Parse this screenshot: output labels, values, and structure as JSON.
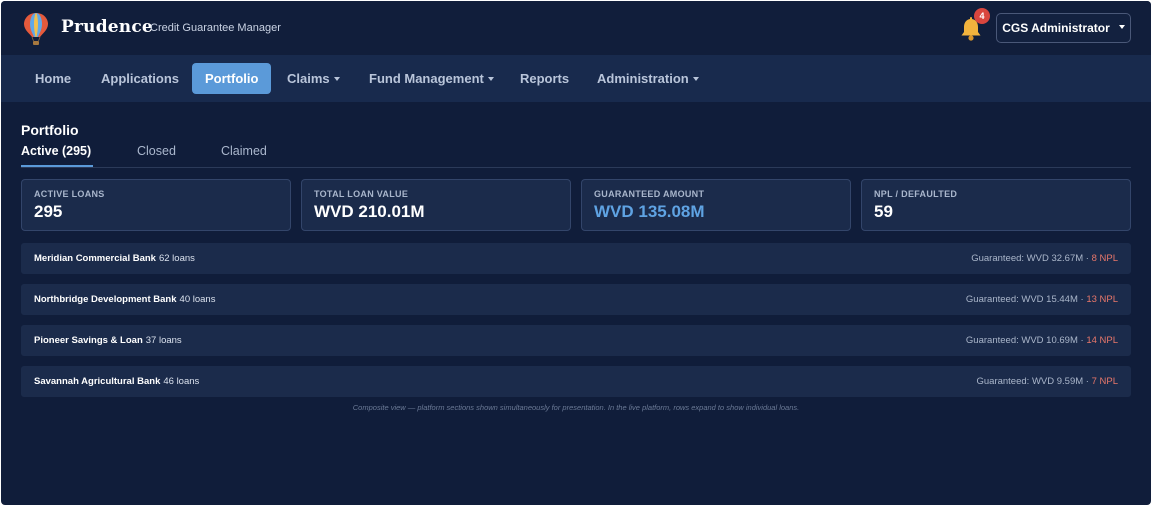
{
  "brand": {
    "name": "Prudence",
    "subtitle": "Credit Guarantee Manager"
  },
  "notifications": {
    "count": "4"
  },
  "user": {
    "label": "CGS Administrator"
  },
  "nav": {
    "items": [
      {
        "label": "Home"
      },
      {
        "label": "Applications"
      },
      {
        "label": "Portfolio"
      },
      {
        "label": "Claims"
      },
      {
        "label": "Fund Management"
      },
      {
        "label": "Reports"
      },
      {
        "label": "Administration"
      }
    ],
    "active": "Portfolio"
  },
  "page": {
    "title": "Portfolio",
    "tabs": [
      {
        "label": "Active (295)"
      },
      {
        "label": "Closed"
      },
      {
        "label": "Claimed"
      }
    ]
  },
  "stats": [
    {
      "label": "ACTIVE LOANS",
      "value": "295"
    },
    {
      "label": "TOTAL LOAN VALUE",
      "value": "WVD 210.01M"
    },
    {
      "label": "GUARANTEED AMOUNT",
      "value": "WVD 135.08M"
    },
    {
      "label": "NPL / DEFAULTED",
      "value": "59"
    }
  ],
  "banks": [
    {
      "name": "Meridian Commercial Bank",
      "loans": "62 loans",
      "guaranteed": "Guaranteed: WVD 32.67M ·",
      "npl": "8 NPL"
    },
    {
      "name": "Northbridge Development Bank",
      "loans": "40 loans",
      "guaranteed": "Guaranteed: WVD 15.44M ·",
      "npl": "13 NPL"
    },
    {
      "name": "Pioneer Savings & Loan",
      "loans": "37 loans",
      "guaranteed": "Guaranteed: WVD 10.69M ·",
      "npl": "14 NPL"
    },
    {
      "name": "Savannah Agricultural Bank",
      "loans": "46 loans",
      "guaranteed": "Guaranteed: WVD 9.59M ·",
      "npl": "7 NPL"
    }
  ],
  "note": "Composite view — platform sections shown simultaneously for presentation. In the live platform, rows expand to show individual loans.",
  "colors": {
    "accent": "#5b9ad9",
    "npl": "#e8776a",
    "background": "#101d3a",
    "badge": "#d9463e"
  },
  "icons": {
    "logo": "hot-air-balloon-icon",
    "notifications": "bell-icon",
    "dropdown": "caret-down-icon"
  }
}
